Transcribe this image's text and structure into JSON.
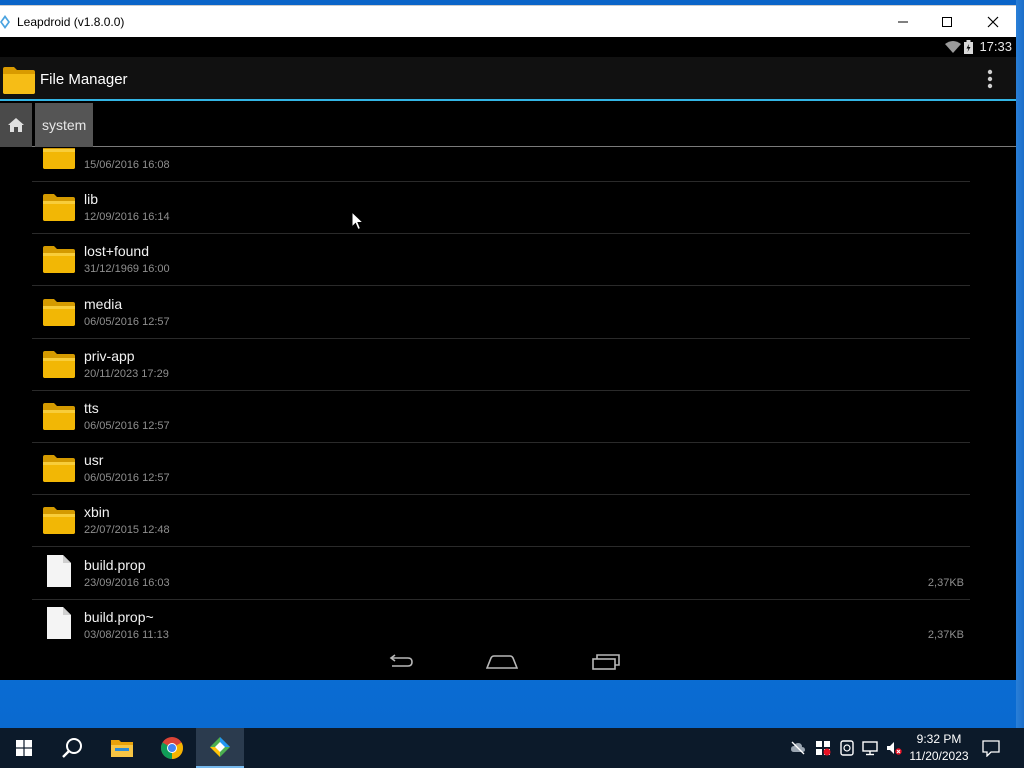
{
  "window": {
    "title": "Leapdroid (v1.8.0.0)"
  },
  "status_bar": {
    "time": "17:33"
  },
  "action_bar": {
    "title": "File Manager"
  },
  "breadcrumb": {
    "current": "system"
  },
  "files": [
    {
      "name": "",
      "date": "15/06/2016 16:08",
      "type": "folder",
      "size": ""
    },
    {
      "name": "lib",
      "date": "12/09/2016 16:14",
      "type": "folder",
      "size": ""
    },
    {
      "name": "lost+found",
      "date": "31/12/1969 16:00",
      "type": "folder",
      "size": ""
    },
    {
      "name": "media",
      "date": "06/05/2016 12:57",
      "type": "folder",
      "size": ""
    },
    {
      "name": "priv-app",
      "date": "20/11/2023 17:29",
      "type": "folder",
      "size": ""
    },
    {
      "name": "tts",
      "date": "06/05/2016 12:57",
      "type": "folder",
      "size": ""
    },
    {
      "name": "usr",
      "date": "06/05/2016 12:57",
      "type": "folder",
      "size": ""
    },
    {
      "name": "xbin",
      "date": "22/07/2015 12:48",
      "type": "folder",
      "size": ""
    },
    {
      "name": "build.prop",
      "date": "23/09/2016 16:03",
      "type": "file",
      "size": "2,37KB"
    },
    {
      "name": "build.prop~",
      "date": "03/08/2016 11:13",
      "type": "file",
      "size": "2,37KB"
    }
  ],
  "taskbar": {
    "time": "9:32 PM",
    "date": "11/20/2023"
  },
  "colors": {
    "accent": "#33b5e5",
    "folder": "#f2b705",
    "desktop": "#0b6fd6",
    "taskbar": "#0c1a2a"
  },
  "icons": [
    "app-logo-icon",
    "minimize-icon",
    "maximize-icon",
    "close-icon",
    "wifi-icon",
    "battery-icon",
    "folder-icon",
    "overflow-menu-icon",
    "home-icon",
    "file-icon",
    "back-icon",
    "home-nav-icon",
    "recents-icon",
    "windows-start-icon",
    "search-icon",
    "file-explorer-icon",
    "chrome-icon",
    "leapdroid-icon",
    "notification-icon"
  ]
}
